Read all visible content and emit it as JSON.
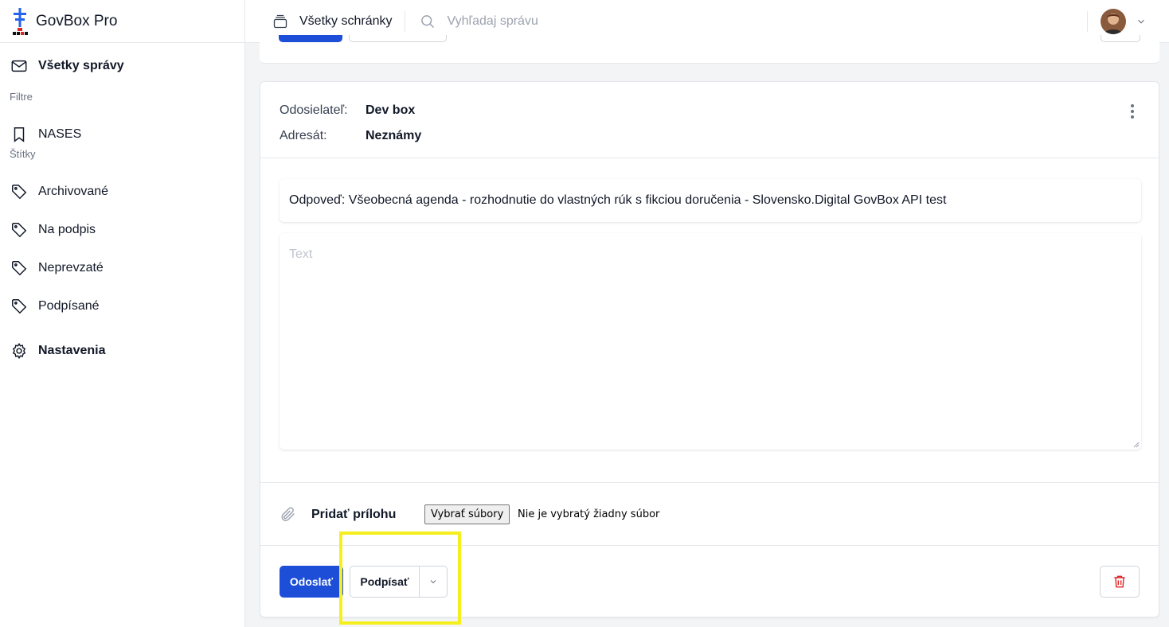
{
  "brand": {
    "name": "GovBox Pro"
  },
  "sidebar": {
    "all_messages": "Všetky správy",
    "filters_label": "Filtre",
    "filters": [
      {
        "label": "NASES"
      }
    ],
    "tags_label": "Štítky",
    "tags": [
      {
        "label": "Archivované"
      },
      {
        "label": "Na podpis"
      },
      {
        "label": "Neprevzaté"
      },
      {
        "label": "Podpísané"
      }
    ],
    "settings": "Nastavenia"
  },
  "header": {
    "mailbox_label": "Všetky schránky",
    "search_placeholder": "Vyhľadaj správu"
  },
  "message": {
    "sender_label": "Odosielateľ:",
    "sender_value": "Dev box",
    "recipient_label": "Adresát:",
    "recipient_value": "Neznámy",
    "subject": "Odpoveď: Všeobecná agenda - rozhodnutie do vlastných rúk s fikciou doručenia - Slovensko.Digital GovBox API test",
    "text_placeholder": "Text"
  },
  "attachments": {
    "label": "Pridať prílohu",
    "file_button": "Vybrať súbory",
    "file_status": "Nie je vybratý žiadny súbor"
  },
  "actions": {
    "send": "Odoslať",
    "sign": "Podpísať"
  },
  "colors": {
    "primary": "#1d4ed8",
    "danger": "#dc2626",
    "highlight": "#f5ef1d"
  }
}
